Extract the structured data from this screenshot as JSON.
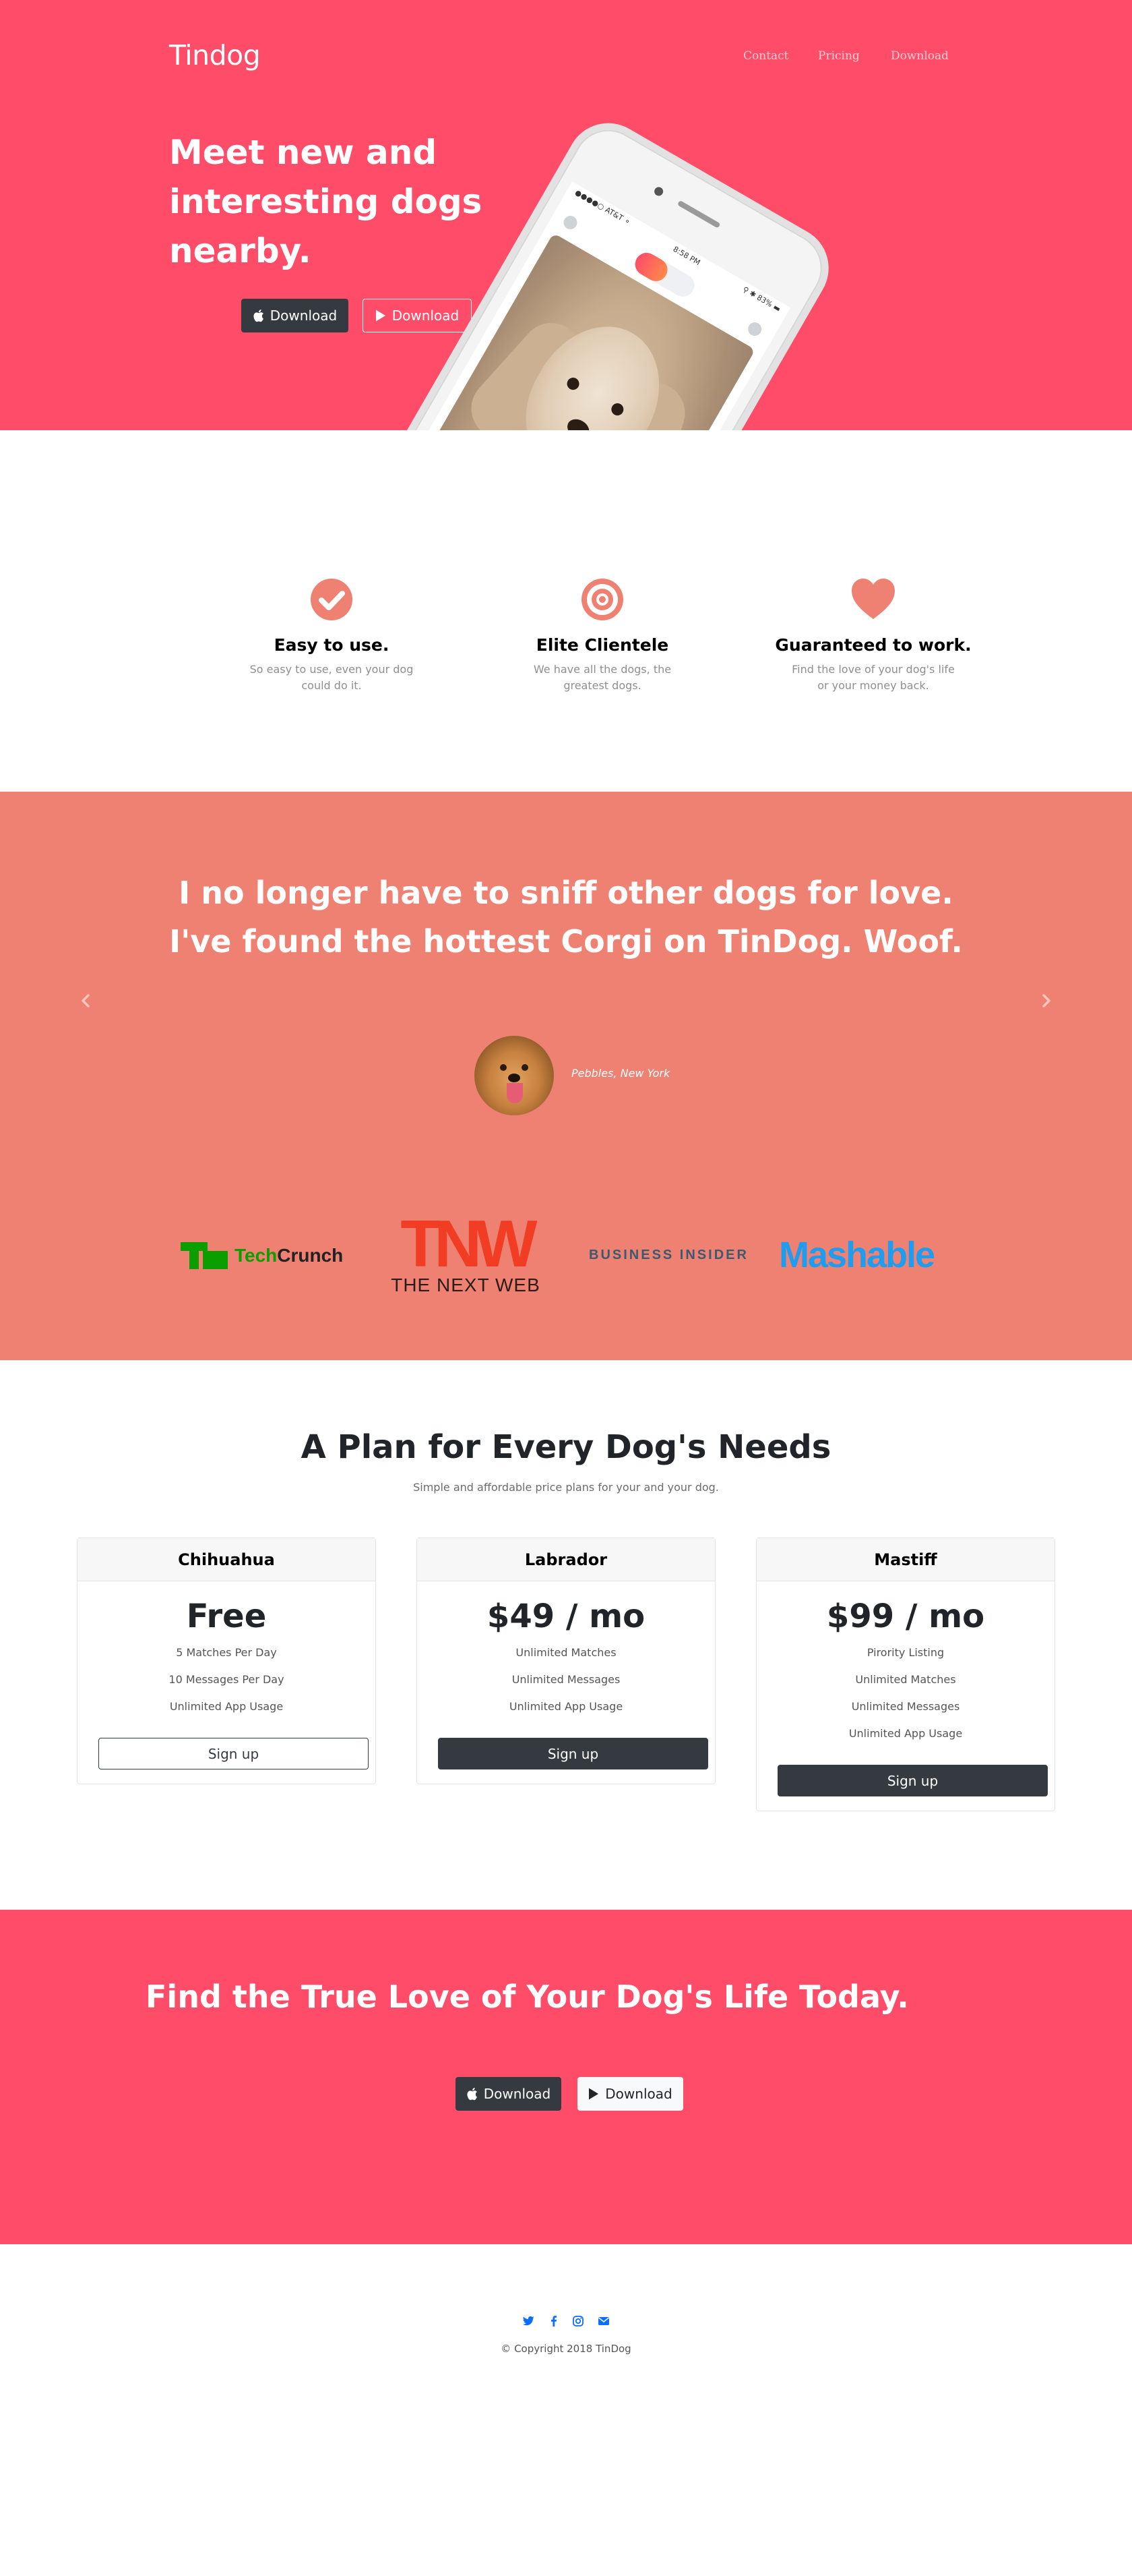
{
  "nav": {
    "brand": "Tindog",
    "links": [
      "Contact",
      "Pricing",
      "Download"
    ]
  },
  "hero": {
    "title": "Meet new and interesting dogs nearby.",
    "buttons": [
      "Download",
      "Download"
    ],
    "phone": {
      "carrier": "●●●●○ AT&T ⚬",
      "time": "8:58 PM",
      "battery": "⚲ ✱ 83% ▬"
    }
  },
  "features": [
    {
      "icon": "check-circle-icon",
      "title": "Easy to use.",
      "text": "So easy to use, even your dog could do it."
    },
    {
      "icon": "bullseye-icon",
      "title": "Elite Clientele",
      "text": "We have all the dogs, the greatest dogs."
    },
    {
      "icon": "heart-icon",
      "title": "Guaranteed to work.",
      "text": "Find the love of your dog's life or your money back."
    }
  ],
  "testimonial": {
    "quote": "I no longer have to sniff other dogs for love. I've found the hottest Corgi on TinDog. Woof.",
    "author": "Pebbles, New York"
  },
  "press": {
    "techcrunch_a": "Tech",
    "techcrunch_b": "Crunch",
    "tnw_mark": "TNW",
    "tnw_name": "THE NEXT WEB",
    "business_insider": "BUSINESS INSIDER",
    "mashable": "Mashable"
  },
  "pricing": {
    "title": "A Plan for Every Dog's Needs",
    "subtitle": "Simple and affordable price plans for your and your dog.",
    "plans": [
      {
        "name": "Chihuahua",
        "price": "Free",
        "features": [
          "5 Matches Per Day",
          "10 Messages Per Day",
          "Unlimited App Usage"
        ],
        "cta": "Sign up"
      },
      {
        "name": "Labrador",
        "price": "$49 / mo",
        "features": [
          "Unlimited Matches",
          "Unlimited Messages",
          "Unlimited App Usage"
        ],
        "cta": "Sign up"
      },
      {
        "name": "Mastiff",
        "price": "$99 / mo",
        "features": [
          "Pirority Listing",
          "Unlimited Matches",
          "Unlimited Messages",
          "Unlimited App Usage"
        ],
        "cta": "Sign up"
      }
    ]
  },
  "cta": {
    "title": "Find the True Love of Your Dog's Life Today.",
    "buttons": [
      "Download",
      "Download"
    ]
  },
  "footer": {
    "social": [
      "twitter-icon",
      "facebook-icon",
      "instagram-icon",
      "envelope-icon"
    ],
    "copyright": "© Copyright 2018 TinDog"
  },
  "colors": {
    "primary": "#ff4c68",
    "secondary": "#ef8172",
    "dark": "#343a40",
    "feature_icon": "#ef8172"
  }
}
